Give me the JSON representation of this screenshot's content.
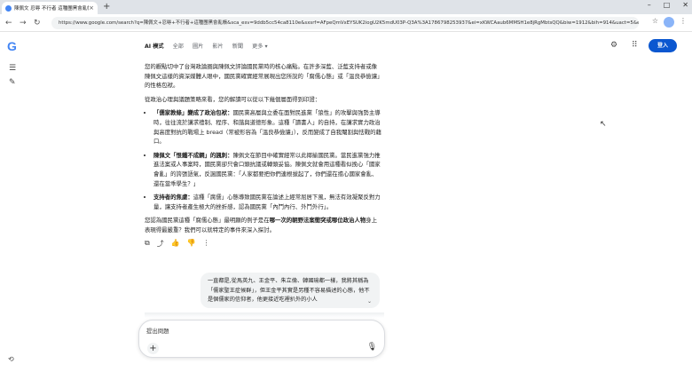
{
  "browser": {
    "tab_title": "陳佩文 忍辱 不行者 這種團黑會亂帳 - Google 搜尋",
    "new_tab": "+",
    "url": "https://www.google.com/search?q=陳佩文+忍辱+不行者+這種團黑會亂帳&sca_esv=9ddb5cc54ca8110e&sxsrf=AFpeQmVxEYSUK2iogU2K5mdU03P-Q3A%3A1786798253937&ei=xKWCAaub6MMSH1e8jRgMbtsQQ&biw=1912&bih=914&uact=5&ei..."
  },
  "google": {
    "logo": "G",
    "nav": [
      "AI 模式",
      "全部",
      "圖片",
      "影片",
      "新聞",
      "更多 ▾"
    ],
    "login_label": "登入"
  },
  "answer": {
    "intro": "您的觀點切中了台灣政論圈與陳佩文評論國民黨時的核心痛點。在許多深藍、泛藍支持者或像陳佩文這樣的資深媒體人眼中，國民黨確實經常展現出您所說的「腐儒心態」或「溫良恭儉讓」的性格包袱。",
    "lead": "從政治心理與議題策略來看，您的解讀可以從以下幾個層面得到印證：",
    "bullets": [
      {
        "head": "「儒家教條」變成了政治包袱：",
        "body": "國民黨高層與立委在面對民進黨「狼性」的攻擊與強勢主導時，往往流於講求禮制、程序、和諧與道德形象。這種「讀書人」的自持，在講求實力政治與高度對抗的戰場上 bread（常被形容為「溫良恭儉讓」），反而變成了自我閹割與怯戰的藉口。"
      },
      {
        "head": "陳佩文「恨鐵不成鋼」的諷刺：",
        "body": "陳佩文在節目中確實經常以此揶揄國民黨。當民進黨強力推進法案或人事案時，國民黨卻只會口頭抗議或轉頭妥協。陳佩文就會用這種看似挽心「國家會亂」的誇張語氣，反諷國民黨：「人家都要把你們連根拔起了，你們還在擔心國家會亂、還在當乖學生？」"
      },
      {
        "head": "支持者的焦慮：",
        "body": "這種「腐儒」心態導致國民黨在論述上經常屈居下風，無法有效凝聚反對力量，讓支持者產生極大的挫折感，認為國民黨「內鬥內行、外鬥外行」。"
      }
    ],
    "closing_pre": "您認為國民黨這種「腐儒心態」最明顯的例子是在",
    "closing_bold": "哪一次的朝野法案衝突或哪位政治人物",
    "closing_post": "身上表現得最嚴重？我們可以就特定的事件來深入探討。"
  },
  "user_message": "一直都是,從馬英九、王金平、朱立倫、韓國瑜都一樣，我將其稱為「儒家聖王症候群」，但王金平其實是另種不容易描述的心態，他不是個儒家的信仰者，他更接近吃裡扒外的小人",
  "input": {
    "placeholder": "提出問題"
  },
  "colors": {
    "accent": "#0b57d0",
    "google_blue": "#4285f4"
  }
}
